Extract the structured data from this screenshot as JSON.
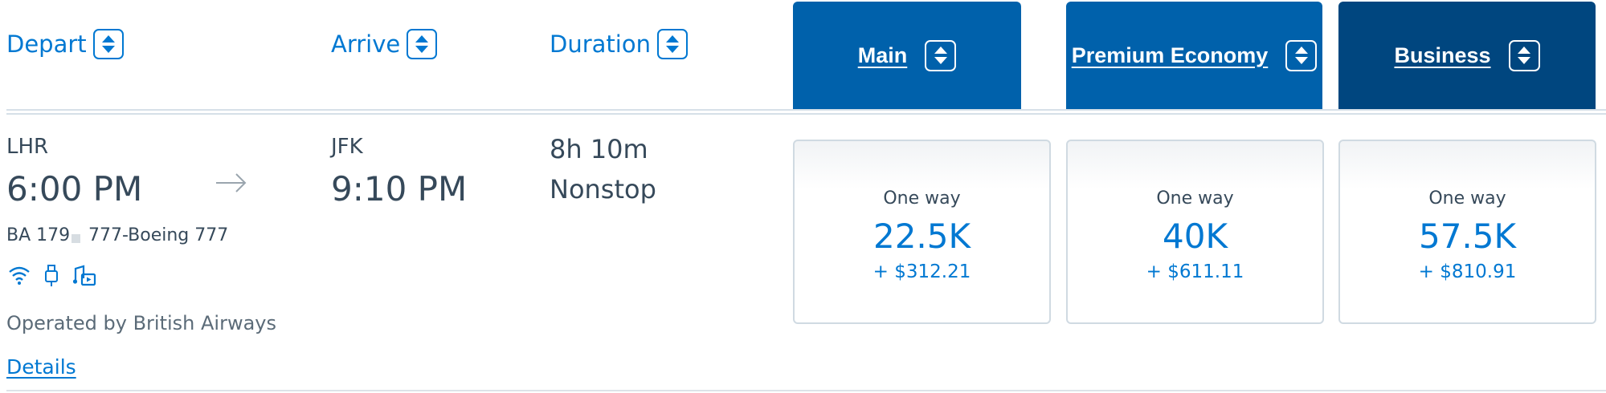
{
  "headers": {
    "depart": "Depart",
    "arrive": "Arrive",
    "duration": "Duration"
  },
  "tabs": [
    {
      "label": "Main",
      "color": "#0061ab"
    },
    {
      "label": "Premium Economy",
      "color": "#0061ab"
    },
    {
      "label": "Business",
      "color": "#00467f"
    }
  ],
  "flight": {
    "origin_code": "LHR",
    "depart_time": "6:00 PM",
    "dest_code": "JFK",
    "arrive_time": "9:10 PM",
    "duration": "8h 10m",
    "stops": "Nonstop",
    "flight_number": "BA 179",
    "aircraft": "777-Boeing 777",
    "amenities": [
      "wifi-icon",
      "usb-power-icon",
      "entertainment-icon"
    ],
    "operated_by": "Operated by British Airways",
    "details_link": "Details"
  },
  "fares": [
    {
      "label": "One way",
      "miles": "22.5K",
      "tax": "+ $312.21"
    },
    {
      "label": "One way",
      "miles": "40K",
      "tax": "+ $611.11"
    },
    {
      "label": "One way",
      "miles": "57.5K",
      "tax": "+ $810.91"
    }
  ],
  "colors": {
    "link_blue": "#0078d2",
    "text_dark": "#36495a",
    "tab_blue": "#0061ab",
    "tab_dark": "#00467f"
  }
}
